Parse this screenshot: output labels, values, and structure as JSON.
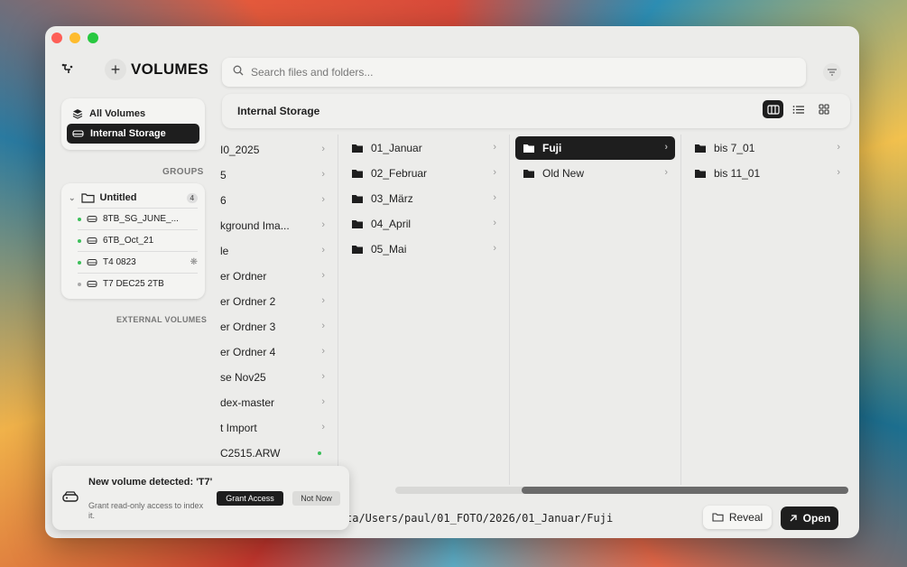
{
  "app": {
    "brand": "VOLUMES",
    "add_symbol": "+",
    "icons": {
      "logo": "network-node-icon",
      "add": "plus-icon",
      "filter": "filter-lines-icon"
    }
  },
  "search": {
    "placeholder": "Search files and folders..."
  },
  "sidebar": {
    "volumes": [
      {
        "label": "All Volumes",
        "icon": "stack-icon",
        "active": false
      },
      {
        "label": "Internal Storage",
        "icon": "drive-icon",
        "active": true
      }
    ],
    "groups_label": "GROUPS",
    "group": {
      "name": "Untitled",
      "count": "4",
      "drives": [
        {
          "label": "8TB_SG_JUNE_...",
          "status": "online",
          "color": "#3cbf5a"
        },
        {
          "label": "6TB_Oct_21",
          "status": "online",
          "color": "#3cbf5a"
        },
        {
          "label": "T4 0823",
          "status": "indexing",
          "color": "#3cbf5a"
        },
        {
          "label": "T7 DEC25 2TB",
          "status": "offline",
          "color": "#aaaaaa"
        }
      ]
    },
    "external_label": "EXTERNAL VOLUMES"
  },
  "content": {
    "title": "Internal Storage",
    "views": [
      "columns",
      "list",
      "grid"
    ],
    "active_view": "columns"
  },
  "columns": [
    {
      "items": [
        {
          "label": "I0_2025",
          "arrow": true
        },
        {
          "label": "5",
          "arrow": true
        },
        {
          "label": "6",
          "arrow": true
        },
        {
          "label": "kground Ima...",
          "arrow": true
        },
        {
          "label": "le",
          "arrow": true
        },
        {
          "label": "er Ordner",
          "arrow": true
        },
        {
          "label": "er Ordner 2",
          "arrow": true
        },
        {
          "label": "er Ordner 3",
          "arrow": true
        },
        {
          "label": "er Ordner 4",
          "arrow": true
        },
        {
          "label": "se Nov25",
          "arrow": true
        },
        {
          "label": "dex-master",
          "arrow": true
        },
        {
          "label": "t Import",
          "arrow": true
        },
        {
          "label": "C2515.ARW",
          "arrow": false,
          "dot": true
        }
      ]
    },
    {
      "items": [
        {
          "label": "01_Januar",
          "selected": false
        },
        {
          "label": "02_Februar",
          "selected": false
        },
        {
          "label": "03_März",
          "selected": false
        },
        {
          "label": "04_April",
          "selected": false
        },
        {
          "label": "05_Mai",
          "selected": false
        }
      ]
    },
    {
      "items": [
        {
          "label": "Fuji",
          "selected": true
        },
        {
          "label": "Old New",
          "selected": false
        }
      ]
    },
    {
      "items": [
        {
          "label": "bis 7_01",
          "selected": false
        },
        {
          "label": "bis 11_01",
          "selected": false
        }
      ]
    }
  ],
  "footer": {
    "path": "ta/Users/paul/01_FOTO/2026/01_Januar/Fuji",
    "reveal_label": "Reveal",
    "open_label": "Open"
  },
  "toast": {
    "title": "New volume detected: 'T7'",
    "subtitle": "Grant read-only access to index it.",
    "grant_label": "Grant Access",
    "notnow_label": "Not Now"
  },
  "colors": {
    "accent": "#1e1e1e",
    "online": "#3cbf5a",
    "offline": "#aaaaaa"
  }
}
